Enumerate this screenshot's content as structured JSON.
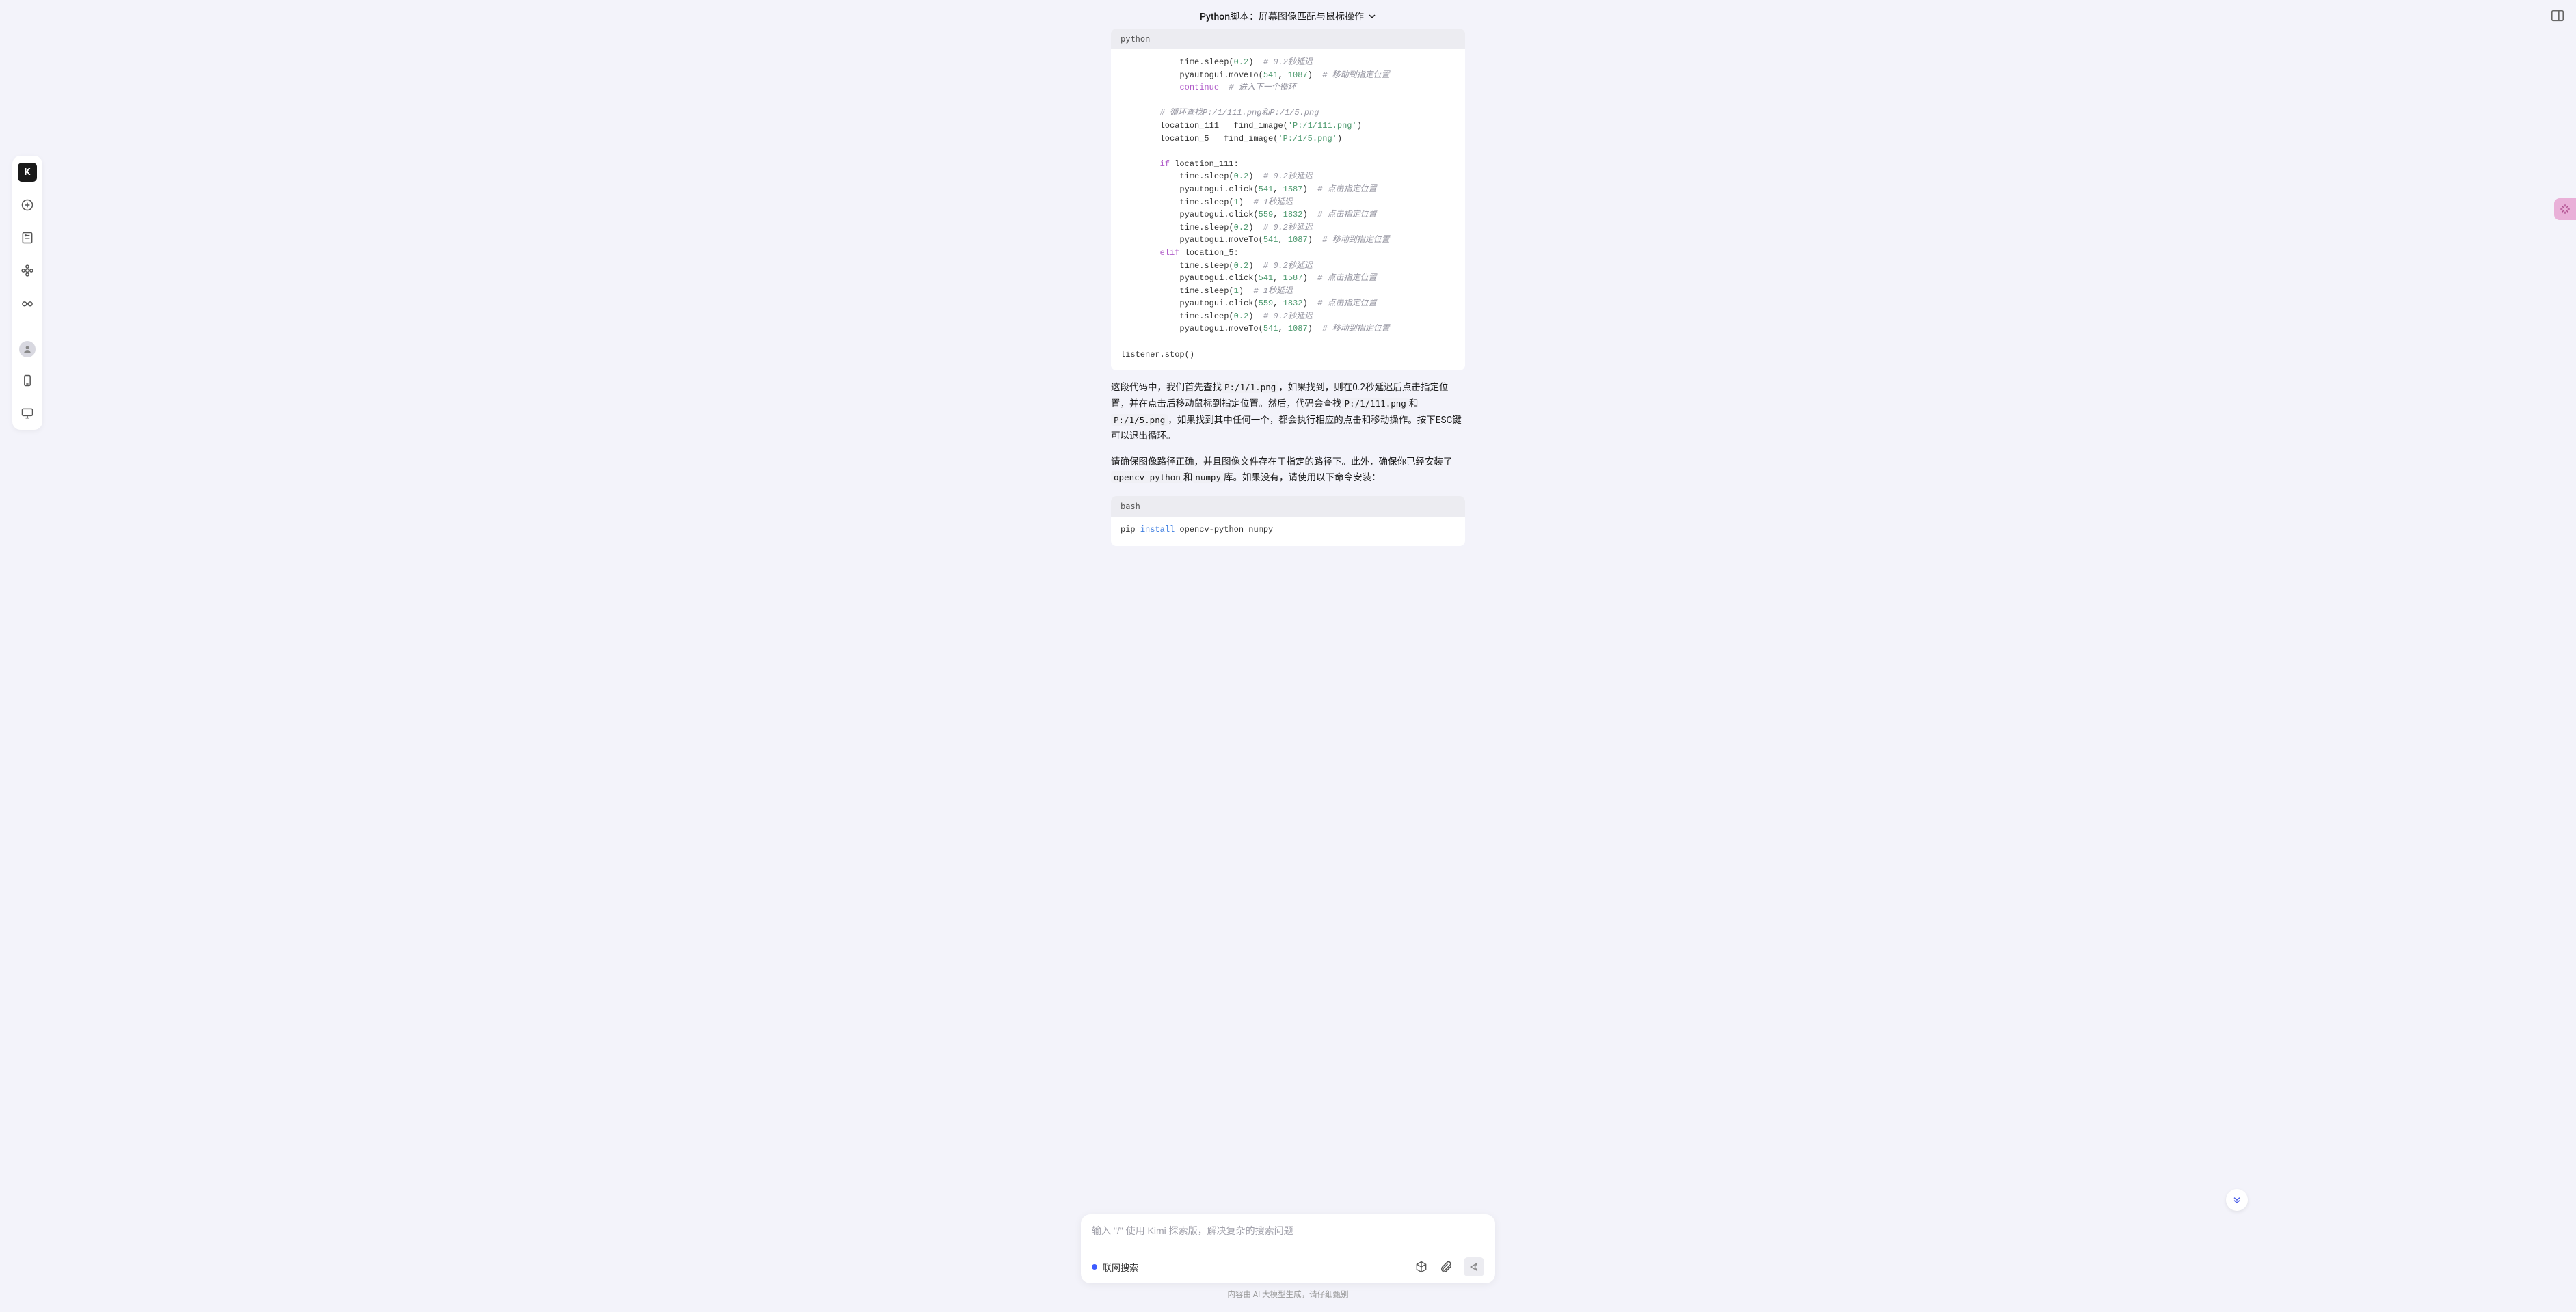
{
  "header": {
    "title": "Python脚本：屏幕图像匹配与鼠标操作"
  },
  "code1": {
    "lang": "python",
    "lines": [
      {
        "indent": 12,
        "tokens": [
          {
            "t": "time.sleep("
          },
          {
            "t": "0.2",
            "c": "num"
          },
          {
            "t": ")  "
          },
          {
            "t": "# 0.2秒延迟",
            "c": "comment"
          }
        ]
      },
      {
        "indent": 12,
        "tokens": [
          {
            "t": "pyautogui.moveTo("
          },
          {
            "t": "541",
            "c": "num"
          },
          {
            "t": ", "
          },
          {
            "t": "1087",
            "c": "num"
          },
          {
            "t": ")  "
          },
          {
            "t": "# 移动到指定位置",
            "c": "comment"
          }
        ]
      },
      {
        "indent": 12,
        "tokens": [
          {
            "t": "continue",
            "c": "kw"
          },
          {
            "t": "  "
          },
          {
            "t": "# 进入下一个循环",
            "c": "comment"
          }
        ]
      },
      {
        "indent": 0,
        "tokens": []
      },
      {
        "indent": 8,
        "tokens": [
          {
            "t": "# 循环查找P:/1/111.png和P:/1/5.png",
            "c": "comment"
          }
        ]
      },
      {
        "indent": 8,
        "tokens": [
          {
            "t": "location_111 "
          },
          {
            "t": "=",
            "c": "kw"
          },
          {
            "t": " find_image("
          },
          {
            "t": "'P:/1/111.png'",
            "c": "str"
          },
          {
            "t": ")"
          }
        ]
      },
      {
        "indent": 8,
        "tokens": [
          {
            "t": "location_5 "
          },
          {
            "t": "=",
            "c": "kw"
          },
          {
            "t": " find_image("
          },
          {
            "t": "'P:/1/5.png'",
            "c": "str"
          },
          {
            "t": ")"
          }
        ]
      },
      {
        "indent": 0,
        "tokens": []
      },
      {
        "indent": 8,
        "tokens": [
          {
            "t": "if",
            "c": "kw"
          },
          {
            "t": " location_111:"
          }
        ]
      },
      {
        "indent": 12,
        "tokens": [
          {
            "t": "time.sleep("
          },
          {
            "t": "0.2",
            "c": "num"
          },
          {
            "t": ")  "
          },
          {
            "t": "# 0.2秒延迟",
            "c": "comment"
          }
        ]
      },
      {
        "indent": 12,
        "tokens": [
          {
            "t": "pyautogui.click("
          },
          {
            "t": "541",
            "c": "num"
          },
          {
            "t": ", "
          },
          {
            "t": "1587",
            "c": "num"
          },
          {
            "t": ")  "
          },
          {
            "t": "# 点击指定位置",
            "c": "comment"
          }
        ]
      },
      {
        "indent": 12,
        "tokens": [
          {
            "t": "time.sleep("
          },
          {
            "t": "1",
            "c": "num"
          },
          {
            "t": ")  "
          },
          {
            "t": "# 1秒延迟",
            "c": "comment"
          }
        ]
      },
      {
        "indent": 12,
        "tokens": [
          {
            "t": "pyautogui.click("
          },
          {
            "t": "559",
            "c": "num"
          },
          {
            "t": ", "
          },
          {
            "t": "1832",
            "c": "num"
          },
          {
            "t": ")  "
          },
          {
            "t": "# 点击指定位置",
            "c": "comment"
          }
        ]
      },
      {
        "indent": 12,
        "tokens": [
          {
            "t": "time.sleep("
          },
          {
            "t": "0.2",
            "c": "num"
          },
          {
            "t": ")  "
          },
          {
            "t": "# 0.2秒延迟",
            "c": "comment"
          }
        ]
      },
      {
        "indent": 12,
        "tokens": [
          {
            "t": "pyautogui.moveTo("
          },
          {
            "t": "541",
            "c": "num"
          },
          {
            "t": ", "
          },
          {
            "t": "1087",
            "c": "num"
          },
          {
            "t": ")  "
          },
          {
            "t": "# 移动到指定位置",
            "c": "comment"
          }
        ]
      },
      {
        "indent": 8,
        "tokens": [
          {
            "t": "elif",
            "c": "kw"
          },
          {
            "t": " location_5:"
          }
        ]
      },
      {
        "indent": 12,
        "tokens": [
          {
            "t": "time.sleep("
          },
          {
            "t": "0.2",
            "c": "num"
          },
          {
            "t": ")  "
          },
          {
            "t": "# 0.2秒延迟",
            "c": "comment"
          }
        ]
      },
      {
        "indent": 12,
        "tokens": [
          {
            "t": "pyautogui.click("
          },
          {
            "t": "541",
            "c": "num"
          },
          {
            "t": ", "
          },
          {
            "t": "1587",
            "c": "num"
          },
          {
            "t": ")  "
          },
          {
            "t": "# 点击指定位置",
            "c": "comment"
          }
        ]
      },
      {
        "indent": 12,
        "tokens": [
          {
            "t": "time.sleep("
          },
          {
            "t": "1",
            "c": "num"
          },
          {
            "t": ")  "
          },
          {
            "t": "# 1秒延迟",
            "c": "comment"
          }
        ]
      },
      {
        "indent": 12,
        "tokens": [
          {
            "t": "pyautogui.click("
          },
          {
            "t": "559",
            "c": "num"
          },
          {
            "t": ", "
          },
          {
            "t": "1832",
            "c": "num"
          },
          {
            "t": ")  "
          },
          {
            "t": "# 点击指定位置",
            "c": "comment"
          }
        ]
      },
      {
        "indent": 12,
        "tokens": [
          {
            "t": "time.sleep("
          },
          {
            "t": "0.2",
            "c": "num"
          },
          {
            "t": ")  "
          },
          {
            "t": "# 0.2秒延迟",
            "c": "comment"
          }
        ]
      },
      {
        "indent": 12,
        "tokens": [
          {
            "t": "pyautogui.moveTo("
          },
          {
            "t": "541",
            "c": "num"
          },
          {
            "t": ", "
          },
          {
            "t": "1087",
            "c": "num"
          },
          {
            "t": ")  "
          },
          {
            "t": "# 移动到指定位置",
            "c": "comment"
          }
        ]
      },
      {
        "indent": 0,
        "tokens": []
      },
      {
        "indent": 0,
        "tokens": [
          {
            "t": "listener.stop()"
          }
        ]
      }
    ]
  },
  "para1": {
    "seg1": "这段代码中，我们首先查找",
    "c1": "P:/1/1.png",
    "seg2": "，如果找到，则在0.2秒延迟后点击指定位置，并在点击后移动鼠标到指定位置。然后，代码会查找",
    "c2": "P:/1/111.png",
    "seg3": "和",
    "c3": "P:/1/5.png",
    "seg4": "，如果找到其中任何一个，都会执行相应的点击和移动操作。按下ESC键可以退出循环。"
  },
  "para2": {
    "seg1": "请确保图像路径正确，并且图像文件存在于指定的路径下。此外，确保你已经安装了",
    "c1": "opencv-python",
    "seg2": "和",
    "c2": "numpy",
    "seg3": "库。如果没有，请使用以下命令安装："
  },
  "code2": {
    "lang": "bash",
    "lines": [
      {
        "indent": 0,
        "tokens": [
          {
            "t": "pip "
          },
          {
            "t": "install",
            "c": "cmd"
          },
          {
            "t": " opencv-python numpy"
          }
        ]
      }
    ]
  },
  "composer": {
    "placeholder": "输入 \"/\" 使用 Kimi 探索版，解决复杂的搜索问题",
    "online_label": "联网搜索"
  },
  "disclaimer": "内容由 AI 大模型生成，请仔细甄别",
  "sidebar": {
    "logo": "K"
  }
}
